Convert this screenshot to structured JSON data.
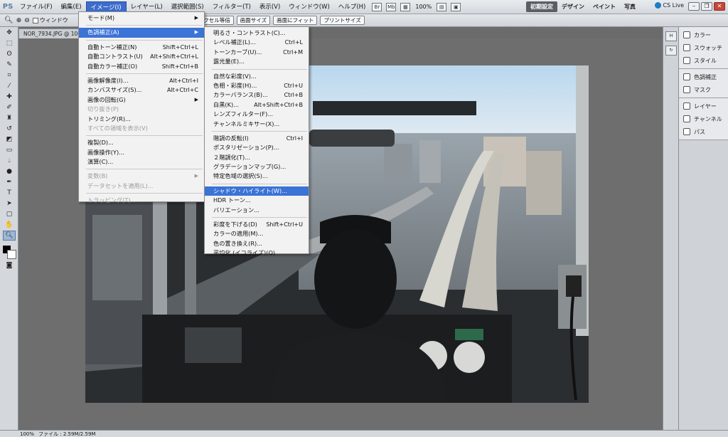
{
  "app": {
    "logo": "PS"
  },
  "menubar": {
    "items": [
      {
        "label": "ファイル(F)"
      },
      {
        "label": "編集(E)"
      },
      {
        "label": "イメージ(I)",
        "active": true
      },
      {
        "label": "レイヤー(L)"
      },
      {
        "label": "選択範囲(S)"
      },
      {
        "label": "フィルター(T)"
      },
      {
        "label": "表示(V)"
      },
      {
        "label": "ウィンドウ(W)"
      },
      {
        "label": "ヘルプ(H)"
      }
    ],
    "bar_icon_1": "Br",
    "bar_icon_2": "Mb",
    "zoom": "100%",
    "workspaces": [
      "初期設定",
      "デザイン",
      "ペイント",
      "写真"
    ],
    "cs_live": "CS Live",
    "window_controls": [
      "–",
      "❐",
      "✕"
    ]
  },
  "options_bar": {
    "checkbox_label": "ウィンドウ",
    "buttons": [
      "ピクセル等倍",
      "画面サイズ",
      "画面にフィット",
      "プリントサイズ"
    ]
  },
  "document": {
    "tab_label": "NOR_7934.JPG @ 100%"
  },
  "image_menu": {
    "items": [
      {
        "label": "モード(M)",
        "shortcut": "",
        "submenu": true
      },
      {
        "sep": true
      },
      {
        "label": "色調補正(A)",
        "shortcut": "",
        "submenu": true,
        "highlight": true
      },
      {
        "sep": true
      },
      {
        "label": "自動トーン補正(N)",
        "shortcut": "Shift+Ctrl+L"
      },
      {
        "label": "自動コントラスト(U)",
        "shortcut": "Alt+Shift+Ctrl+L"
      },
      {
        "label": "自動カラー補正(O)",
        "shortcut": "Shift+Ctrl+B"
      },
      {
        "sep": true
      },
      {
        "label": "画像解像度(I)...",
        "shortcut": "Alt+Ctrl+I"
      },
      {
        "label": "カンバスサイズ(S)...",
        "shortcut": "Alt+Ctrl+C"
      },
      {
        "label": "画像の回転(G)",
        "shortcut": "",
        "submenu": true
      },
      {
        "label": "切り抜き(P)",
        "shortcut": "",
        "disabled": true
      },
      {
        "label": "トリミング(R)...",
        "shortcut": ""
      },
      {
        "label": "すべての領域を表示(V)",
        "shortcut": "",
        "disabled": true
      },
      {
        "sep": true
      },
      {
        "label": "複製(D)...",
        "shortcut": ""
      },
      {
        "label": "画像操作(Y)...",
        "shortcut": ""
      },
      {
        "label": "演算(C)...",
        "shortcut": ""
      },
      {
        "sep": true
      },
      {
        "label": "変数(B)",
        "shortcut": "",
        "submenu": true,
        "disabled": true
      },
      {
        "label": "データセットを適用(L)...",
        "shortcut": "",
        "disabled": true
      },
      {
        "sep": true
      },
      {
        "label": "トラッピング(T)...",
        "shortcut": "",
        "disabled": true
      }
    ]
  },
  "adjust_menu": {
    "items": [
      {
        "label": "明るさ・コントラスト(C)...",
        "shortcut": ""
      },
      {
        "label": "レベル補正(L)...",
        "shortcut": "Ctrl+L"
      },
      {
        "label": "トーンカーブ(U)...",
        "shortcut": "Ctrl+M"
      },
      {
        "label": "露光量(E)...",
        "shortcut": ""
      },
      {
        "sep": true
      },
      {
        "label": "自然な彩度(V)...",
        "shortcut": ""
      },
      {
        "label": "色相・彩度(H)...",
        "shortcut": "Ctrl+U"
      },
      {
        "label": "カラーバランス(B)...",
        "shortcut": "Ctrl+B"
      },
      {
        "label": "白黒(K)...",
        "shortcut": "Alt+Shift+Ctrl+B"
      },
      {
        "label": "レンズフィルター(F)...",
        "shortcut": ""
      },
      {
        "label": "チャンネルミキサー(X)...",
        "shortcut": ""
      },
      {
        "sep": true
      },
      {
        "label": "階調の反転(I)",
        "shortcut": "Ctrl+I"
      },
      {
        "label": "ポスタリゼーション(P)...",
        "shortcut": ""
      },
      {
        "label": "２階調化(T)...",
        "shortcut": ""
      },
      {
        "label": "グラデーションマップ(G)...",
        "shortcut": ""
      },
      {
        "label": "特定色域の選択(S)...",
        "shortcut": ""
      },
      {
        "sep": true
      },
      {
        "label": "シャドウ・ハイライト(W)...",
        "shortcut": "",
        "highlight": true
      },
      {
        "label": "HDR トーン...",
        "shortcut": ""
      },
      {
        "label": "バリエーション...",
        "shortcut": ""
      },
      {
        "sep": true
      },
      {
        "label": "彩度を下げる(D)",
        "shortcut": "Shift+Ctrl+U"
      },
      {
        "label": "カラーの適用(M)...",
        "shortcut": ""
      },
      {
        "label": "色の置き換え(R)...",
        "shortcut": ""
      },
      {
        "label": "平均化 (イコライズ)(Q)",
        "shortcut": ""
      }
    ]
  },
  "panels": {
    "group1": [
      {
        "label": "カラー",
        "icon": "color-icon"
      },
      {
        "label": "スウォッチ",
        "icon": "swatch-icon"
      },
      {
        "label": "スタイル",
        "icon": "style-icon"
      }
    ],
    "group2": [
      {
        "label": "色調補正",
        "icon": "adjustment-icon"
      },
      {
        "label": "マスク",
        "icon": "mask-icon"
      }
    ],
    "group3": [
      {
        "label": "レイヤー",
        "icon": "layers-icon"
      },
      {
        "label": "チャンネル",
        "icon": "channels-icon"
      },
      {
        "label": "パス",
        "icon": "paths-icon"
      }
    ]
  },
  "status_bar": {
    "zoom": "100%",
    "doc_info": "ファイル : 2.59M/2.59M"
  },
  "colors": {
    "highlight": "#3b73d6",
    "canvas_bg": "#6e6e6e"
  }
}
